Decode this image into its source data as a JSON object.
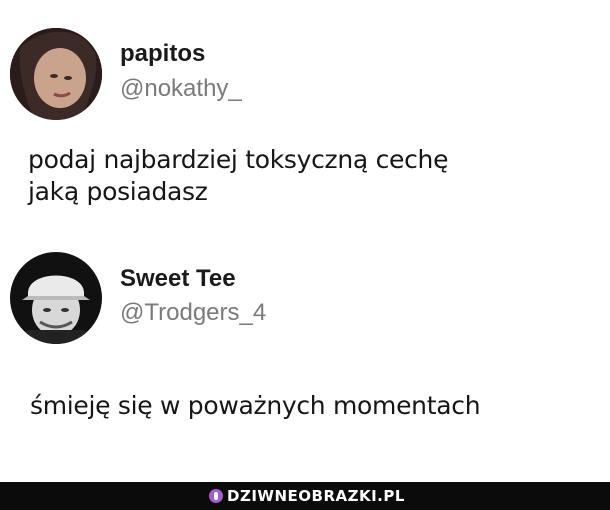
{
  "posts": [
    {
      "display_name": "papitos",
      "handle": "@nokathy_",
      "text_lines": [
        "podaj najbardziej toksyczną cechę",
        "jaką posiadasz"
      ],
      "avatar_icon": "user-avatar-woman"
    },
    {
      "display_name": "Sweet Tee",
      "handle": "@Trodgers_4",
      "text_lines": [
        "śmieję się w poważnych momentach"
      ],
      "avatar_icon": "user-avatar-man-cap"
    }
  ],
  "footer": {
    "watermark": "DZIWNEOBRAZKI.PL",
    "icon": "site-logo-icon"
  },
  "colors": {
    "name": "#1a1a1a",
    "handle": "#7a7a7a",
    "footer_bg": "#0b0b0b",
    "logo_accent": "#a45cc8"
  }
}
